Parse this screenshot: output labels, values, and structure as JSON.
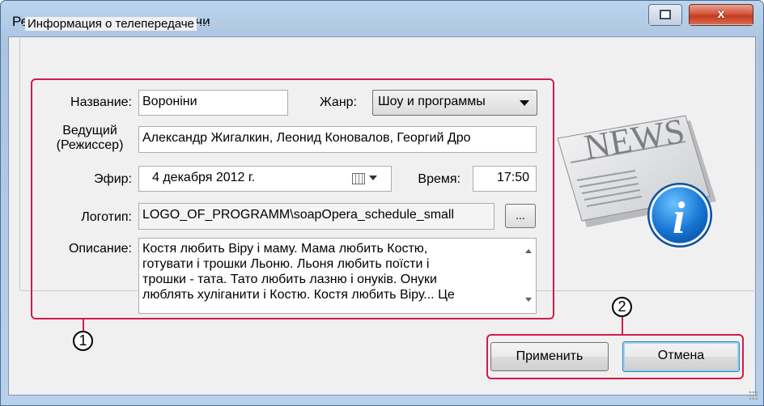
{
  "window": {
    "title": "Редактивароние телепередачи",
    "close_label": "x"
  },
  "group": {
    "title": "Информация о телепередаче"
  },
  "form": {
    "name_label": "Название:",
    "name_value": "Вороніни",
    "genre_label": "Жанр:",
    "genre_value": "Шоу и программы",
    "host_label_line1": "Ведущий",
    "host_label_line2": "(Режиссер)",
    "host_value": "Александр Жигалкин, Леонид Коновалов, Георгий Дро",
    "air_label": "Эфир:",
    "air_value": "4 декабря  2012 г.",
    "time_label": "Время:",
    "time_value": "17:50",
    "logo_label": "Логотип:",
    "logo_value": "LOGO_OF_PROGRAMM\\soapOpera_schedule_small",
    "browse_label": "...",
    "description_label": "Описание:",
    "description_lines": [
      "Костя любить Віру і маму. Мама любить Костю,",
      "готувати і трошки Льоню. Льоня любить поїсти і",
      "трошки - тата. Тато любить лазню і онуків. Онуки",
      "люблять хуліганити і Костю. Костя любить Віру... Це"
    ]
  },
  "image": {
    "news_text": "NEWS",
    "info_letter": "i"
  },
  "annotations": {
    "marker_1": "1",
    "marker_2": "2",
    "color": "#d41a4c"
  },
  "buttons": {
    "apply_label": "Применить",
    "cancel_label": "Отмена"
  }
}
